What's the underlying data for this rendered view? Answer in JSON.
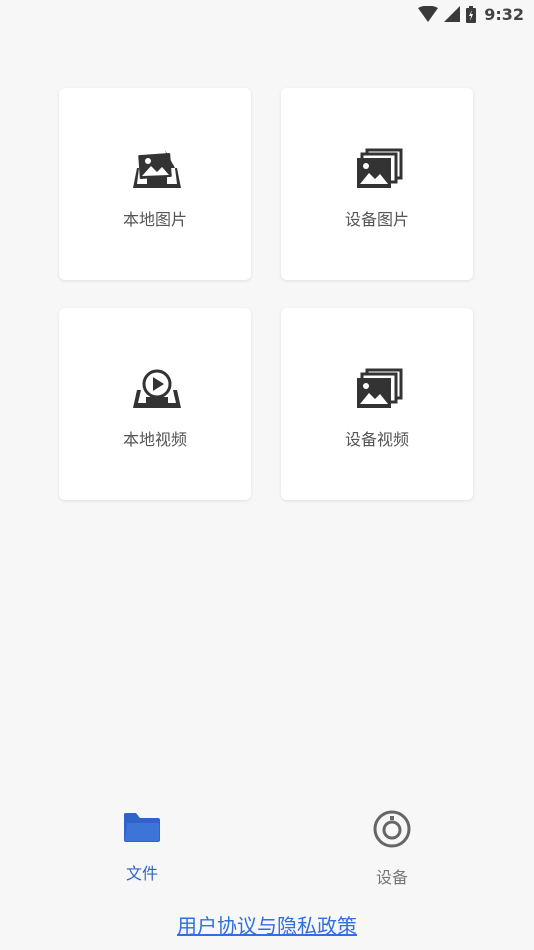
{
  "status_bar": {
    "time": "9:32",
    "icons": [
      "wifi-icon",
      "signal-icon",
      "battery-icon"
    ]
  },
  "tiles": [
    {
      "label": "本地图片",
      "icon": "local-image-icon"
    },
    {
      "label": "设备图片",
      "icon": "device-image-icon"
    },
    {
      "label": "本地视频",
      "icon": "local-video-icon"
    },
    {
      "label": "设备视频",
      "icon": "device-video-icon"
    }
  ],
  "bottom_nav": {
    "items": [
      {
        "label": "文件",
        "icon": "folder-icon",
        "active": true
      },
      {
        "label": "设备",
        "icon": "device-icon",
        "active": false
      }
    ]
  },
  "footer": {
    "link": "用户协议与隐私政策"
  },
  "colors": {
    "accent": "#2f63c8",
    "inactive": "#777777",
    "icon_dark": "#333333",
    "link": "#2f6fe0"
  }
}
